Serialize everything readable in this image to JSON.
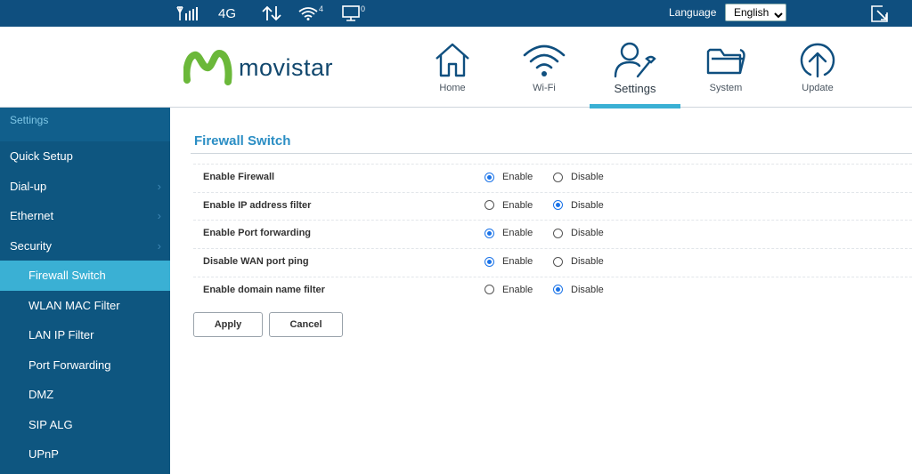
{
  "statusbar": {
    "network_type": "4G",
    "wifi_clients": "4",
    "lan_clients": "0",
    "language_label": "Language",
    "language_value": "English",
    "icons": [
      "signal-icon",
      "transfer-arrows-icon",
      "wifi-icon",
      "monitor-icon",
      "logout-icon"
    ]
  },
  "brand": {
    "name": "movistar"
  },
  "nav": {
    "home": "Home",
    "wifi": "Wi-Fi",
    "settings": "Settings",
    "system": "System",
    "update": "Update",
    "active": "Settings",
    "accent_color": "#3ab0d4"
  },
  "sidebar": {
    "header": "Settings",
    "items": {
      "quick_setup": "Quick Setup",
      "dialup": "Dial-up",
      "ethernet": "Ethernet",
      "security": "Security",
      "firewall_switch": "Firewall Switch",
      "wlan_mac_filter": "WLAN MAC Filter",
      "lan_ip_filter": "LAN IP Filter",
      "port_forwarding": "Port Forwarding",
      "dmz": "DMZ",
      "sip_alg": "SIP ALG",
      "upnp": "UPnP"
    }
  },
  "main": {
    "title": "Firewall Switch",
    "enable_label": "Enable",
    "disable_label": "Disable",
    "rows": [
      {
        "label": "Enable Firewall",
        "value": "Enable"
      },
      {
        "label": "Enable IP address filter",
        "value": "Disable"
      },
      {
        "label": "Enable Port forwarding",
        "value": "Enable"
      },
      {
        "label": "Disable WAN port ping",
        "value": "Enable"
      },
      {
        "label": "Enable domain name filter",
        "value": "Disable"
      }
    ],
    "apply_label": "Apply",
    "cancel_label": "Cancel"
  }
}
